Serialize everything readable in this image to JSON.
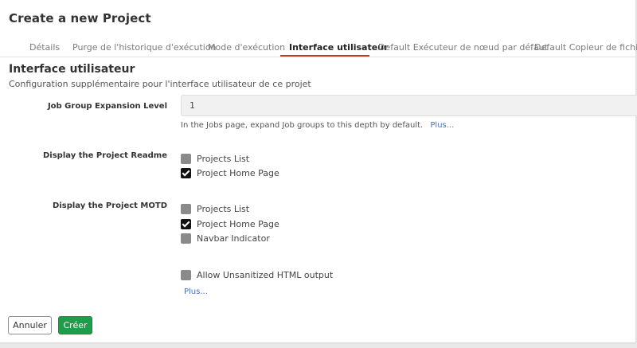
{
  "title": "Create a new Project",
  "tabs": [
    {
      "label": "Détails"
    },
    {
      "label": "Purge de l'historique d'exécution"
    },
    {
      "label": "Mode d'exécution"
    },
    {
      "label": "Interface utilisateur"
    },
    {
      "label": "Default Exécuteur de nœud par défaut"
    },
    {
      "label": "Default Copieur de fichier"
    }
  ],
  "active_tab": "Interface utilisateur",
  "accent_color": "#c0392b",
  "section": {
    "title": "Interface utilisateur",
    "description": "Configuration supplémentaire pour l'interface utilisateur de ce projet"
  },
  "job_group": {
    "label": "Job Group Expansion Level",
    "value": "1",
    "help": "In the Jobs page, expand Job groups to this depth by default.",
    "more": "Plus..."
  },
  "readme": {
    "label": "Display the Project Readme",
    "options": [
      {
        "label": "Projects List",
        "checked": false
      },
      {
        "label": "Project Home Page",
        "checked": true
      }
    ]
  },
  "motd": {
    "label": "Display the Project MOTD",
    "options": [
      {
        "label": "Projects List",
        "checked": false
      },
      {
        "label": "Project Home Page",
        "checked": true
      },
      {
        "label": "Navbar Indicator",
        "checked": false
      }
    ]
  },
  "unsanitized": {
    "label": "Allow Unsanitized HTML output",
    "checked": false,
    "more": "Plus..."
  },
  "buttons": {
    "cancel": "Annuler",
    "create": "Créer",
    "create_color": "#1f9d4b"
  }
}
